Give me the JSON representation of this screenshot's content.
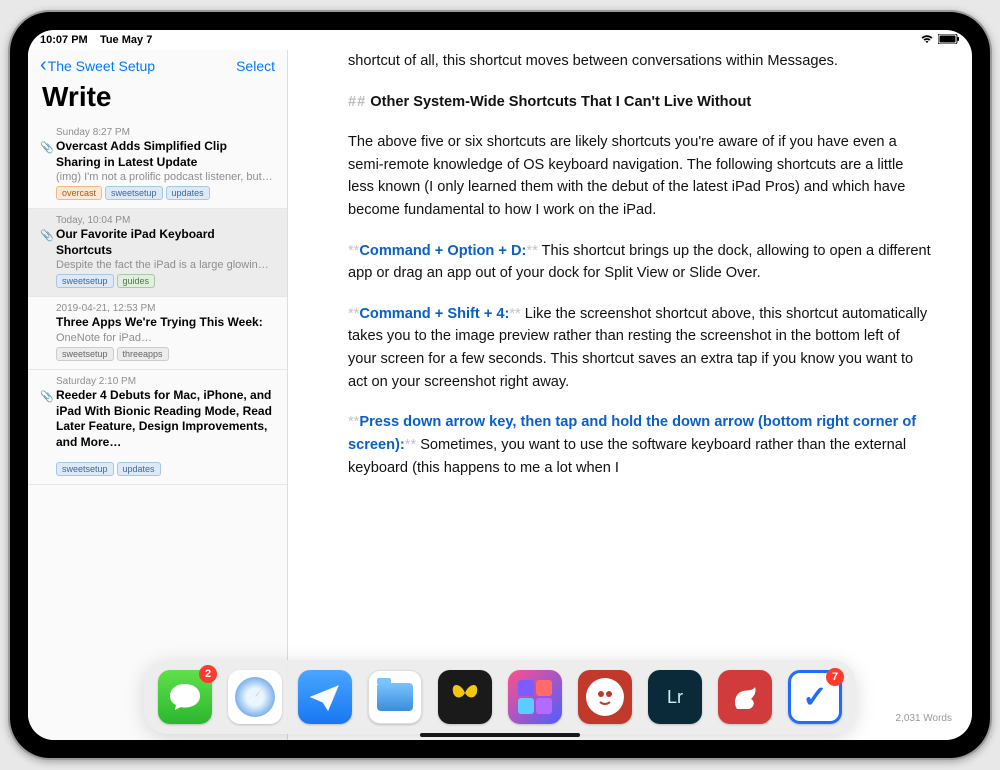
{
  "status": {
    "time": "10:07 PM",
    "date": "Tue May 7"
  },
  "sidebar": {
    "back_label": "The Sweet Setup",
    "select_label": "Select",
    "title": "Write",
    "notes": [
      {
        "date": "Sunday 8:27 PM",
        "title": "Overcast Adds Simplified Clip Sharing in Latest Update",
        "preview": "(img) I'm not a prolific podcast listener, but it…",
        "tags": [
          {
            "text": "overcast",
            "cls": "orange"
          },
          {
            "text": "sweetsetup",
            "cls": "blue"
          },
          {
            "text": "updates",
            "cls": "blue"
          }
        ],
        "has_attachment": true,
        "selected": false
      },
      {
        "date": "Today, 10:04 PM",
        "title": "Our Favorite iPad Keyboard Shortcuts",
        "preview": "Despite the fact the iPad is a large glowing touchscreen, it almost feels like it was built to…",
        "tags": [
          {
            "text": "sweetsetup",
            "cls": "blue"
          },
          {
            "text": "guides",
            "cls": "green"
          }
        ],
        "has_attachment": true,
        "selected": true
      },
      {
        "date": "2019-04-21, 12:53 PM",
        "title": "Three Apps We're Trying This Week:",
        "preview": "OneNote for iPad…",
        "tags": [
          {
            "text": "sweetsetup",
            "cls": "gray"
          },
          {
            "text": "threeapps",
            "cls": "gray"
          }
        ],
        "has_attachment": false,
        "selected": false
      },
      {
        "date": "Saturday 2:10 PM",
        "title": "Reeder 4 Debuts for Mac, iPhone, and iPad With Bionic Reading Mode, Read Later Feature, Design Improvements, and More…",
        "preview": "",
        "tags": [
          {
            "text": "sweetsetup",
            "cls": "blue"
          },
          {
            "text": "updates",
            "cls": "blue"
          }
        ],
        "has_attachment": true,
        "selected": false
      }
    ]
  },
  "editor": {
    "p0": "shortcut of all, this shortcut moves between conversations within Messages.",
    "hashes": "##",
    "heading": "Other System-Wide Shortcuts That I Can't Live Without",
    "p1": "The above five or six shortcuts are likely shortcuts you're aware of if you have even a semi-remote knowledge of OS keyboard navigation. The following shortcuts are a little less known (I only learned them with the debut of the latest iPad Pros) and which have become fundamental to how I work on the iPad.",
    "s2_stars": "**",
    "s2_bold": "Command + Option + D:",
    "s2_rest": " This shortcut brings up the dock, allowing to open a different app or drag an app out of your dock for Split View or Slide Over.",
    "s3_bold": "Command + Shift + 4:",
    "s3_rest": " Like the screenshot shortcut above, this shortcut automatically takes you to the image preview rather than resting the screenshot in the bottom left of your screen for a few seconds. This shortcut saves an extra tap if you know you want to act on your screenshot right away.",
    "s4_bold": "Press down arrow key, then tap and hold the down arrow (bottom right corner of screen):",
    "s4_rest": " Sometimes, you want to use the software keyboard rather than the external keyboard (this happens to me a lot when I",
    "word_count": "2,031 Words"
  },
  "dock": {
    "items": [
      {
        "name": "messages-app",
        "cls": "ic-messages",
        "badge": "2"
      },
      {
        "name": "safari-app",
        "cls": "ic-safari",
        "badge": ""
      },
      {
        "name": "mail-app",
        "cls": "ic-mail",
        "badge": ""
      },
      {
        "name": "files-app",
        "cls": "ic-files",
        "badge": ""
      },
      {
        "name": "drafts-app",
        "cls": "ic-butterfly",
        "badge": ""
      },
      {
        "name": "shortcuts-app",
        "cls": "ic-shortcuts",
        "badge": ""
      },
      {
        "name": "reader-app",
        "cls": "ic-red1",
        "badge": ""
      },
      {
        "name": "lightroom-app",
        "cls": "ic-lightroom",
        "badge": ""
      },
      {
        "name": "bear-app",
        "cls": "ic-bear",
        "badge": ""
      },
      {
        "name": "things-app",
        "cls": "ic-things",
        "badge": "7"
      }
    ]
  }
}
